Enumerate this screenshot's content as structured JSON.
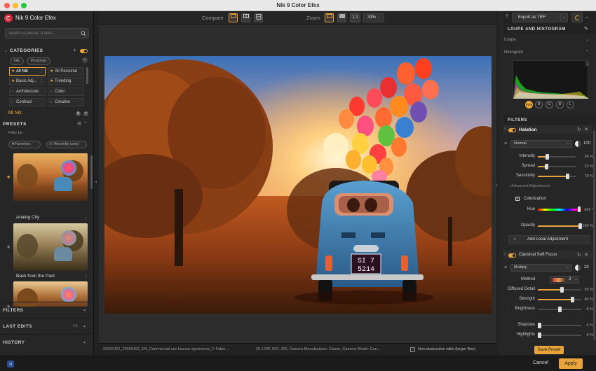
{
  "app": {
    "title": "Nik 9 Color Efex",
    "brand": "Nik 9 Color Efex"
  },
  "colors": {
    "accent": "#e8a33a",
    "panel": "#262626",
    "canvas": "#2d2d2d"
  },
  "search": {
    "placeholder": "Search a preset, a filter..."
  },
  "categories": {
    "header": "CATEGORIES",
    "tabs": [
      "Nik",
      "Personal"
    ],
    "items": [
      {
        "label": "All Nik",
        "star": true,
        "selected": true
      },
      {
        "label": "All Personal",
        "star": true,
        "selected": false
      },
      {
        "label": "Basic Adj...",
        "star": true,
        "selected": false
      },
      {
        "label": "Trending",
        "star": true,
        "selected": false
      },
      {
        "label": "Architecture",
        "star": false,
        "selected": false
      },
      {
        "label": "Color",
        "star": false,
        "selected": false
      },
      {
        "label": "Contrast",
        "star": false,
        "selected": false
      },
      {
        "label": "Creative",
        "star": false,
        "selected": false
      }
    ]
  },
  "current_category": "All Nik",
  "presets": {
    "header": "PRESETS",
    "filter_by": "Filter by:",
    "filters": [
      "Favorites",
      "Recently used"
    ],
    "items": [
      {
        "label": "Analog City"
      },
      {
        "label": "Back from the Past"
      }
    ]
  },
  "left_sections": {
    "filters": "FILTERS",
    "last_edits": "LAST EDITS",
    "last_edits_count": "15",
    "history": "HISTORY"
  },
  "toolbar": {
    "compare_label": "Compare",
    "zoom_label": "Zoom",
    "zoom_fit": "1:1",
    "zoom_value": "33%"
  },
  "export": {
    "label": "Export as TIFF"
  },
  "right": {
    "loupe_header": "LOUPE AND HISTOGRAM",
    "loupe_label": "Loupe",
    "histogram_label": "Histogram",
    "histo_channels": [
      "RGB",
      "R",
      "G",
      "B",
      "L"
    ],
    "filters_header": "FILTERS"
  },
  "halation": {
    "name": "Halation",
    "blend_mode": "Normal",
    "opacity_value": "100",
    "params": [
      {
        "label": "Intensity",
        "value": "24 %",
        "level": 0.24
      },
      {
        "label": "Spread",
        "value": "22 %",
        "level": 0.22
      },
      {
        "label": "Sensitivity",
        "value": "78 %",
        "level": 0.78
      }
    ],
    "advanced": "Advanced Adjustments",
    "colorization": "Colorization",
    "hue_label": "Hue",
    "hue_value": "342 °",
    "opacity_label": "Opacity",
    "opacity_pct": "100 %",
    "add_local": "Add Local Adjustment"
  },
  "soft_focus": {
    "name": "Classical Soft Focus",
    "blend_mode": "Multiply",
    "opacity_value": "20",
    "method_label": "Method",
    "method_value": "3",
    "params": [
      {
        "label": "Diffused Detail",
        "value": "55 %",
        "level": 0.55
      },
      {
        "label": "Strength",
        "value": "80 %",
        "level": 0.8
      },
      {
        "label": "Brightness",
        "value": "0 %",
        "level": 0.5
      }
    ],
    "shadows_label": "Shadows",
    "shadows_value": "0 %",
    "highlights_label": "Highlights",
    "highlights_value": "0 %"
  },
  "status": {
    "file": "20250422_20350422_EN_Commercial use license agreement_© Fabio ...",
    "meta": "26.1 MP, ISO: 200, Camera Manufacturer: Canon, Camera Model: Can...",
    "nondestructive": "Non-destructive edits (larger files)"
  },
  "buttons": {
    "save_preset": "Save Preset",
    "cancel": "Cancel",
    "apply": "Apply"
  },
  "plate": {
    "line1": "SI 7",
    "line2": "5214"
  }
}
